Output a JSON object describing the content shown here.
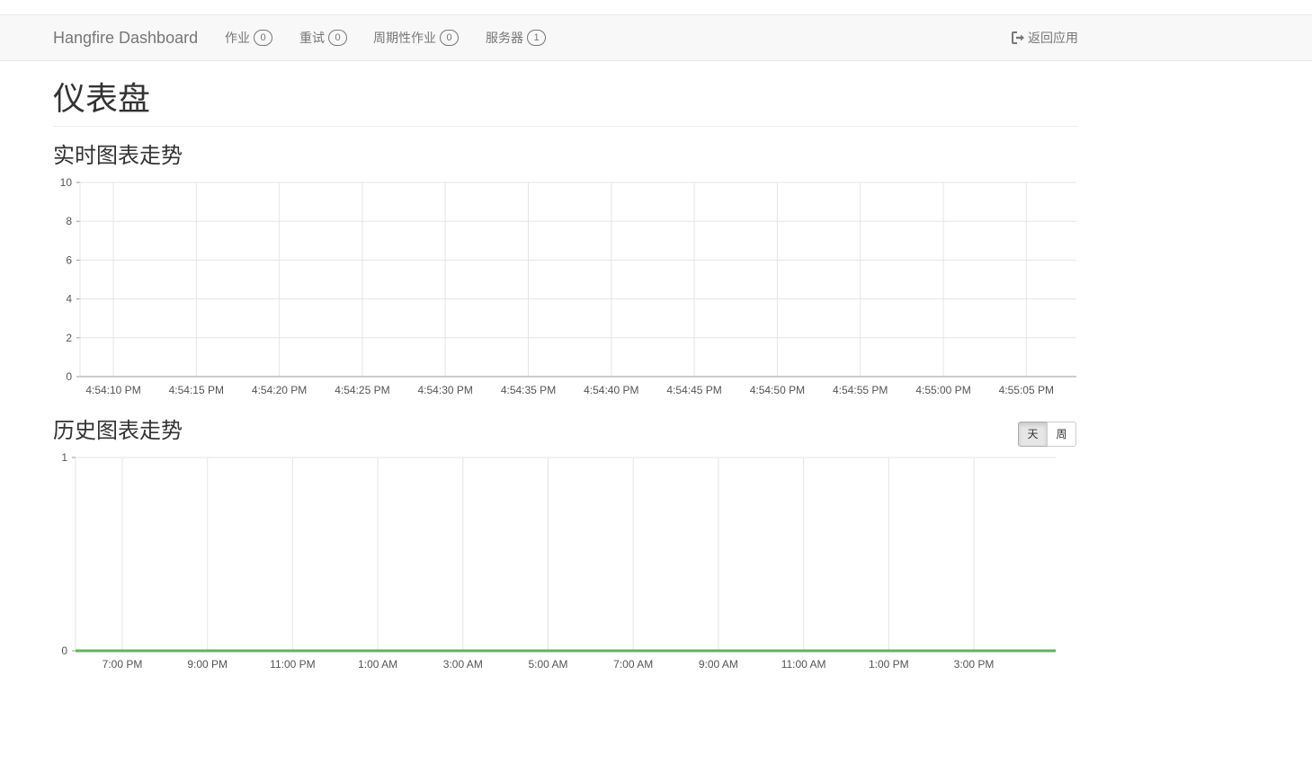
{
  "navbar": {
    "brand": "Hangfire Dashboard",
    "items": [
      {
        "label": "作业",
        "count": "0"
      },
      {
        "label": "重试",
        "count": "0"
      },
      {
        "label": "周期性作业",
        "count": "0"
      },
      {
        "label": "服务器",
        "count": "1"
      }
    ],
    "back_label": "返回应用"
  },
  "page": {
    "title": "仪表盘"
  },
  "realtime": {
    "title": "实时图表走势"
  },
  "history": {
    "title": "历史图表走势",
    "toggle": {
      "day_label": "天",
      "week_label": "周",
      "selected": "day"
    }
  },
  "colors": {
    "grid": "#e5e5e5",
    "axis": "#999999",
    "series_succeeded": "#62b35f",
    "series_failed": "#d9534f"
  },
  "chart_data": [
    {
      "type": "line",
      "title": "",
      "x": [
        "4:54:10 PM",
        "4:54:15 PM",
        "4:54:20 PM",
        "4:54:25 PM",
        "4:54:30 PM",
        "4:54:35 PM",
        "4:54:40 PM",
        "4:54:45 PM",
        "4:54:50 PM",
        "4:54:55 PM",
        "4:55:00 PM",
        "4:55:05 PM"
      ],
      "series": [],
      "ylim": [
        0,
        10
      ],
      "yticks": [
        0,
        2,
        4,
        6,
        8,
        10
      ],
      "grid": true
    },
    {
      "type": "line",
      "title": "",
      "x": [
        "7:00 PM",
        "9:00 PM",
        "11:00 PM",
        "1:00 AM",
        "3:00 AM",
        "5:00 AM",
        "7:00 AM",
        "9:00 AM",
        "11:00 AM",
        "1:00 PM",
        "3:00 PM"
      ],
      "series": [
        {
          "values": [
            0,
            0,
            0,
            0,
            0,
            0,
            0,
            0,
            0,
            0,
            0
          ]
        }
      ],
      "ylim": [
        0,
        1
      ],
      "yticks": [
        0,
        1
      ],
      "grid": true
    }
  ]
}
